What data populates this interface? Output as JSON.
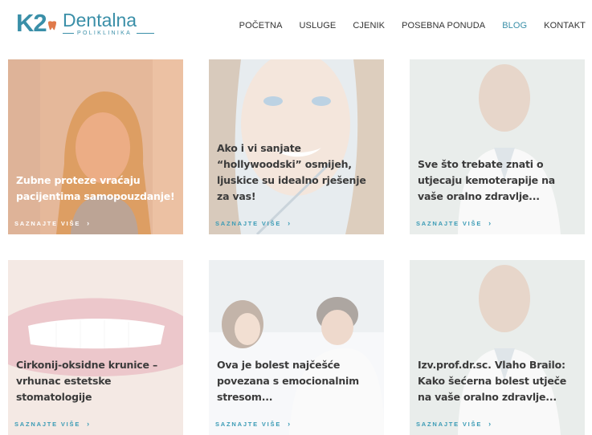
{
  "brand": {
    "k2": "K2",
    "name": "Dentalna",
    "sub": "POLIKLINIKA",
    "accent": "#3a8fa8",
    "logo_mark_color": "#e07a4a"
  },
  "nav": {
    "items": [
      {
        "label": "POČETNA"
      },
      {
        "label": "USLUGE"
      },
      {
        "label": "CJENIK"
      },
      {
        "label": "POSEBNA PONUDA"
      },
      {
        "label": "BLOG",
        "active": true
      },
      {
        "label": "KONTAKT"
      }
    ]
  },
  "posts": [
    {
      "title": "Zubne proteze vraćaju pacijentima samopouzdanje!",
      "more": "SAZNAJTE VIŠE",
      "arrow": "›",
      "image": "smiling-woman-photo"
    },
    {
      "title": "Ako i vi sanjate “hollywoodski” osmijeh, ljuskice su idealno rješenje za vas!",
      "more": "SAZNAJTE VIŠE",
      "arrow": "›",
      "image": "woman-dental-exam-photo"
    },
    {
      "title": "Sve što trebate znati o utjecaju kemoterapije na vaše oralno zdravlje...",
      "more": "SAZNAJTE VIŠE",
      "arrow": "›",
      "image": "doctor-portrait-photo"
    },
    {
      "title": "Cirkonij-oksidne krunice – vrhunac estetske stomatologije",
      "more": "SAZNAJTE VIŠE",
      "arrow": "›",
      "image": "smile-closeup-photo"
    },
    {
      "title": "Ova je bolest najčešće povezana s emocionalnim stresom...",
      "more": "SAZNAJTE VIŠE",
      "arrow": "›",
      "image": "couple-in-bed-photo"
    },
    {
      "title": "Izv.prof.dr.sc. Vlaho Brailo: Kako šećerna bolest utječe na vaše oralno zdravlje...",
      "more": "SAZNAJTE VIŠE",
      "arrow": "›",
      "image": "doctor-portrait-photo"
    }
  ]
}
